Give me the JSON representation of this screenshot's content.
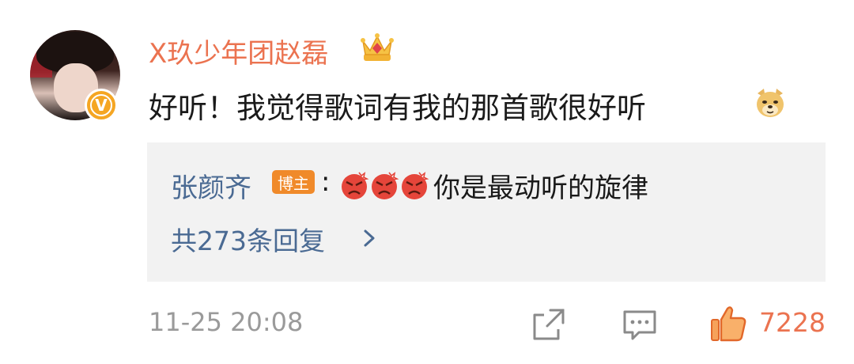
{
  "comment": {
    "username": "X玖少年团赵磊",
    "text": "好听！我觉得歌词有我的那首歌很好听",
    "timestamp": "11-25 20:08",
    "like_count": "7228"
  },
  "reply": {
    "author": "张颜齐",
    "author_tag": "博主",
    "separator": ":",
    "text": "你是最动听的旋律",
    "more_replies": "共273条回复"
  },
  "avatar": {
    "badge": "V"
  },
  "icons": {
    "crown": "crown-icon",
    "dog": "doge-emoji-icon",
    "angry": "angry-emoji-icon",
    "chevron": "chevron-right-icon",
    "share": "share-icon",
    "comment": "comment-icon",
    "like": "thumbs-up-icon"
  },
  "colors": {
    "username": "#eb7350",
    "link": "#4a6a93",
    "like": "#eb7350",
    "tag": "#f08a2a",
    "muted": "#9a9a9a"
  }
}
